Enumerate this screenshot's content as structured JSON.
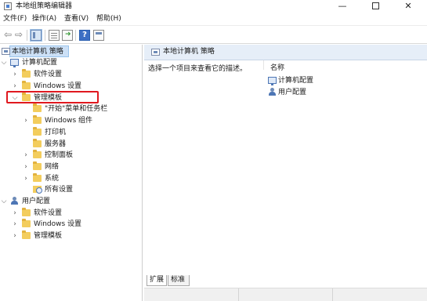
{
  "window": {
    "title": "本地组策略编辑器",
    "controls": {
      "minimize": "—",
      "close": "✕"
    }
  },
  "menubar": {
    "items": [
      "文件(F)",
      "操作(A)",
      "查看(V)",
      "帮助(H)"
    ]
  },
  "toolbar": {
    "buttons": [
      "back-icon",
      "forward-icon",
      "show-pane-icon",
      "list-icon",
      "export-icon",
      "help-icon",
      "properties-icon"
    ],
    "help_label": "?"
  },
  "tree": {
    "root": "本地计算机 策略",
    "computer_config": {
      "label": "计算机配置",
      "software": "软件设置",
      "windows": "Windows 设置",
      "admin_templates": {
        "label": "管理模板",
        "children": [
          "\"开始\"菜单和任务栏",
          "Windows 组件",
          "打印机",
          "服务器",
          "控制面板",
          "网络",
          "系统",
          "所有设置"
        ]
      }
    },
    "user_config": {
      "label": "用户配置",
      "software": "软件设置",
      "windows": "Windows 设置",
      "admin_templates": "管理模板"
    }
  },
  "content": {
    "header": "本地计算机 策略",
    "description": "选择一个项目来查看它的描述。",
    "column_name": "名称",
    "items": [
      "计算机配置",
      "用户配置"
    ]
  },
  "tabs": [
    "扩展",
    "标准"
  ],
  "colors": {
    "highlight_box": "#e0191f",
    "selection": "#cce0f6",
    "header_bg": "#e6eef8"
  }
}
